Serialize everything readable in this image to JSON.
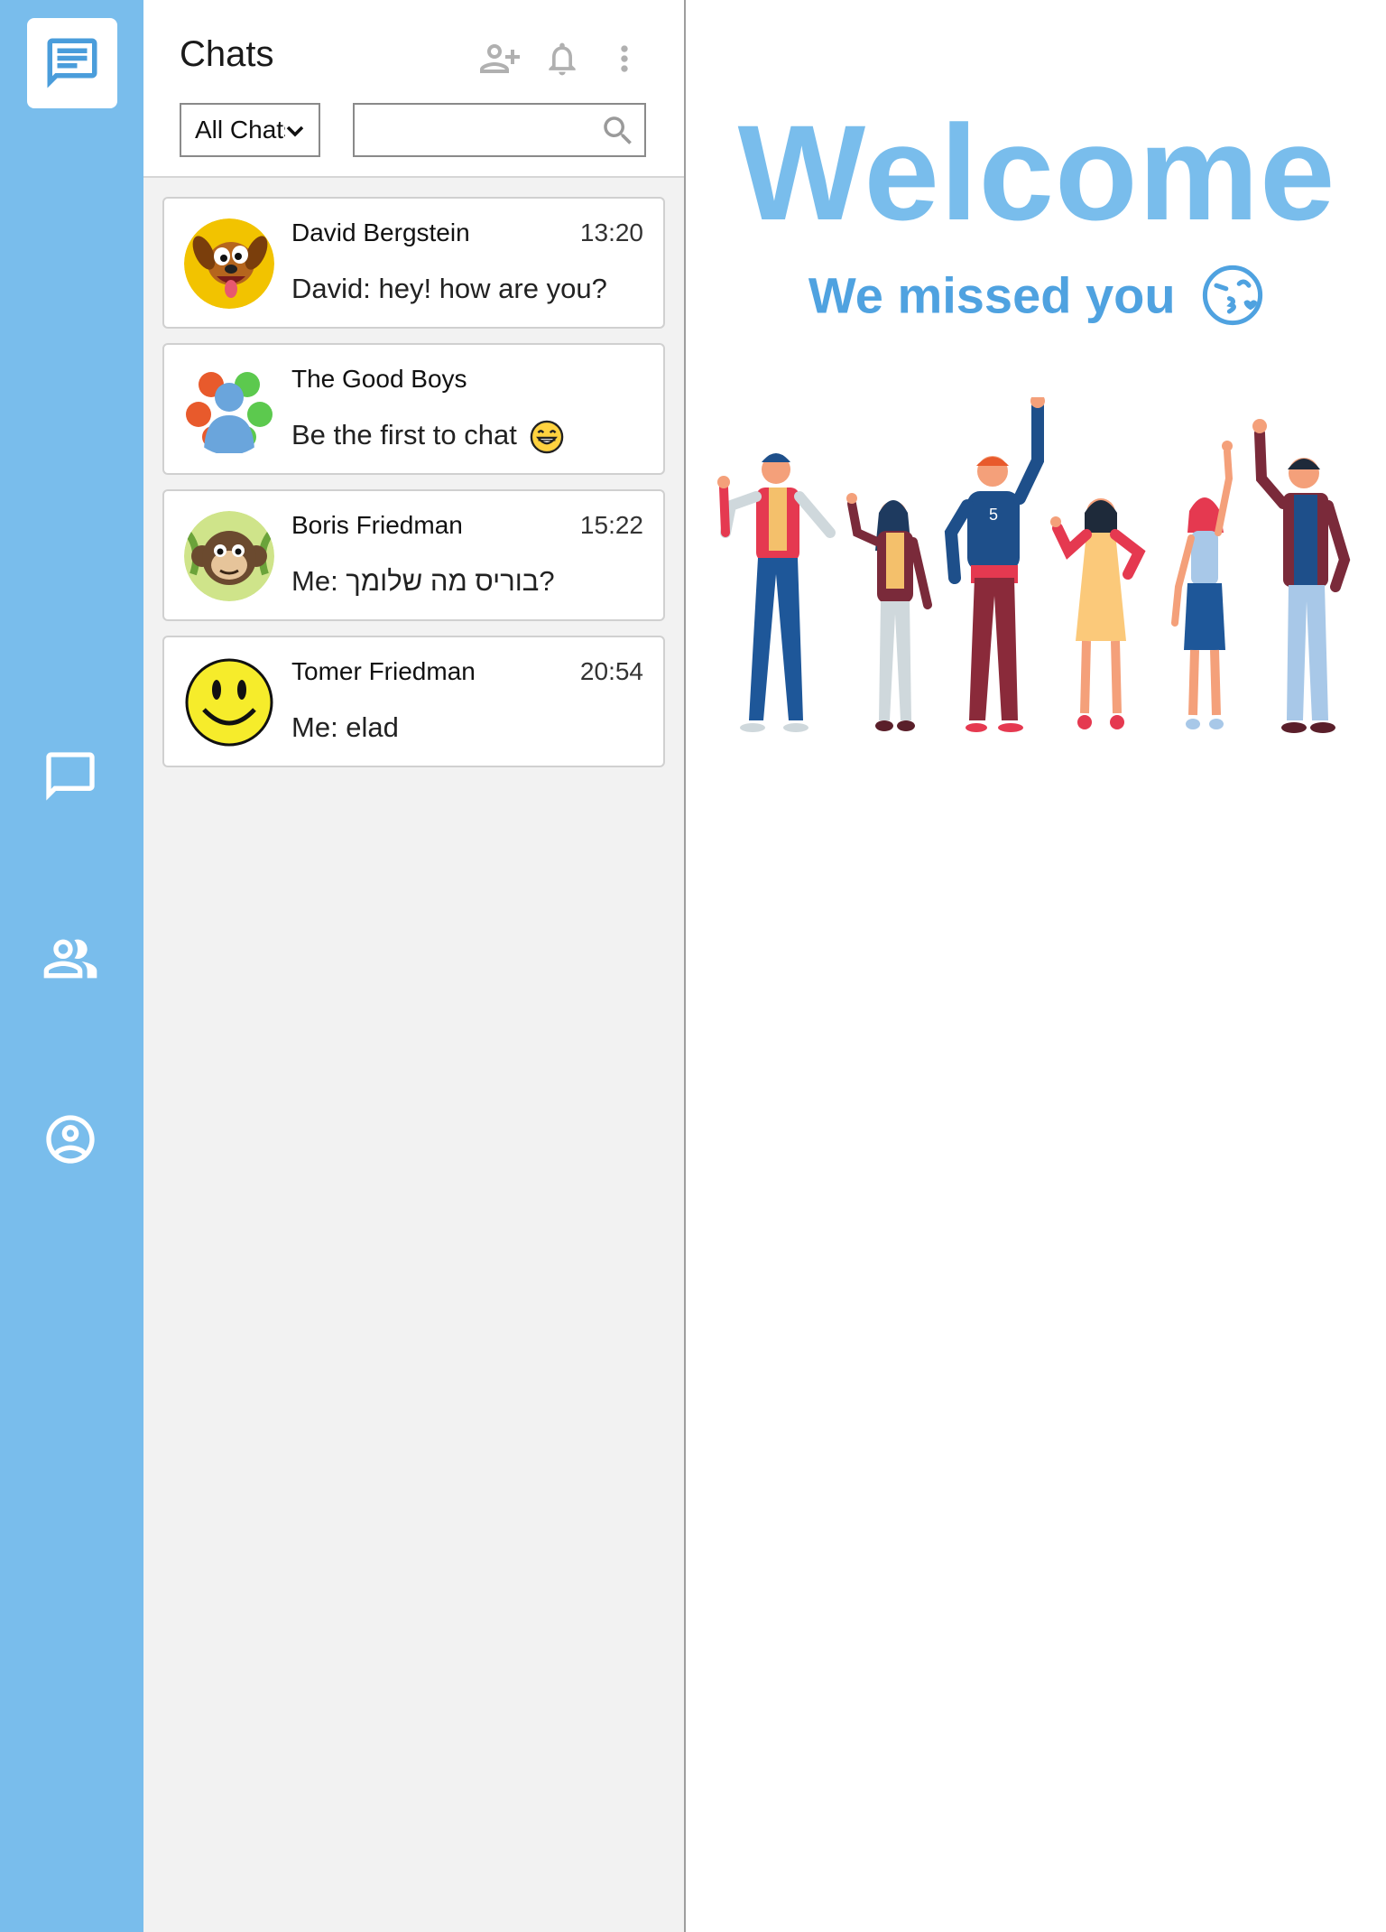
{
  "rail": {
    "items": [
      {
        "name": "chats",
        "icon": "chat-list-icon",
        "active": true
      },
      {
        "name": "messages",
        "icon": "chat-bubble-icon"
      },
      {
        "name": "contacts",
        "icon": "people-icon"
      },
      {
        "name": "profile",
        "icon": "account-circle-icon"
      }
    ],
    "color": "#79bdec"
  },
  "header": {
    "title": "Chats",
    "icons": [
      "add-contact-icon",
      "bell-icon",
      "more-vert-icon"
    ],
    "filter_value": "All Chats",
    "search_placeholder": ""
  },
  "chats": [
    {
      "name": "David Bergstein",
      "time": "13:20",
      "message": "David: hey! how are you?",
      "avatar": "dog-avatar"
    },
    {
      "name": "The Good Boys",
      "time": "",
      "message": "Be the first to chat",
      "avatar": "group-avatar",
      "emoji": "grinning-face-icon"
    },
    {
      "name": "Boris Friedman",
      "time": "15:22",
      "message": "Me: בוריס מה שלומך?",
      "avatar": "monkey-avatar"
    },
    {
      "name": "Tomer Friedman",
      "time": "20:54",
      "message": "Me: elad",
      "avatar": "smiley-avatar"
    }
  ],
  "main": {
    "welcome": "Welcome",
    "subtitle": "We missed you",
    "subtitle_emoji": "kissing-face-icon",
    "illustration": "waving-people-illustration",
    "accent": "#79bdec"
  }
}
